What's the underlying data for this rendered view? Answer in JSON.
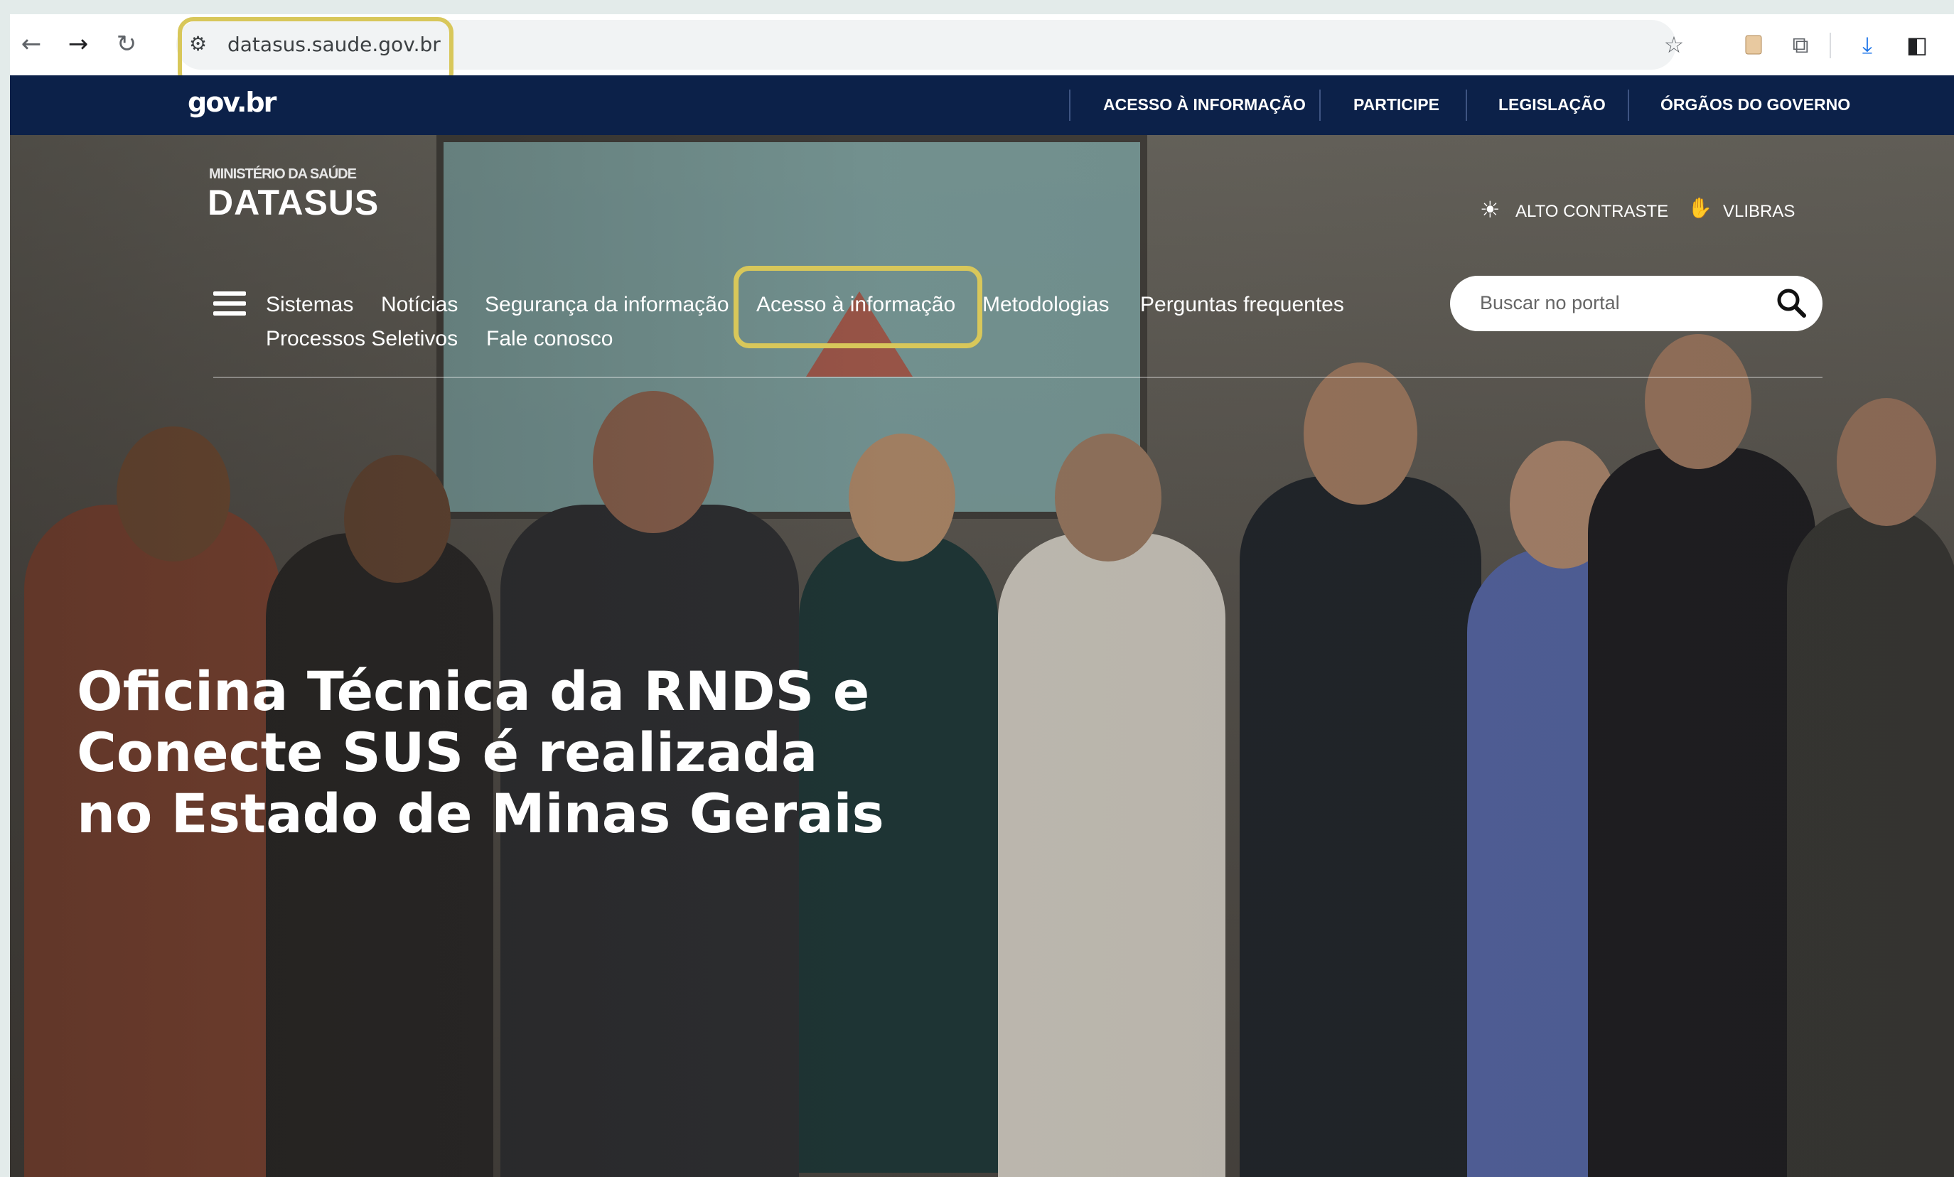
{
  "browser": {
    "url": "datasus.saude.gov.br",
    "back_icon": "←",
    "forward_icon": "→",
    "reload_icon": "↻",
    "site_info_icon": "⚙",
    "bookmark_icon": "☆",
    "extension_icon": "⧉",
    "download_icon": "⤓",
    "sidepanel_icon": "◧"
  },
  "govbar": {
    "logo": "gov.br",
    "links": [
      "ACESSO À INFORMAÇÃO",
      "PARTICIPE",
      "LEGISLAÇÃO",
      "ÓRGÃOS DO GOVERNO"
    ]
  },
  "header": {
    "ministry": "MINISTÉRIO DA SAÚDE",
    "brand": "DATASUS",
    "high_contrast": "ALTO CONTRASTE",
    "vlibras": "VLIBRAS"
  },
  "menu": {
    "items": [
      "Sistemas",
      "Notícias",
      "Segurança da informação",
      "Acesso à informação",
      "Metodologias",
      "Perguntas frequentes",
      "Processos Seletivos",
      "Fale conosco"
    ]
  },
  "search": {
    "placeholder": "Buscar no portal"
  },
  "hero": {
    "headline": "Oficina Técnica da RNDS e Conecte SUS é realizada no Estado de Minas Gerais"
  },
  "colors": {
    "govbar": "#0c2149",
    "highlight": "#d8c75a"
  }
}
